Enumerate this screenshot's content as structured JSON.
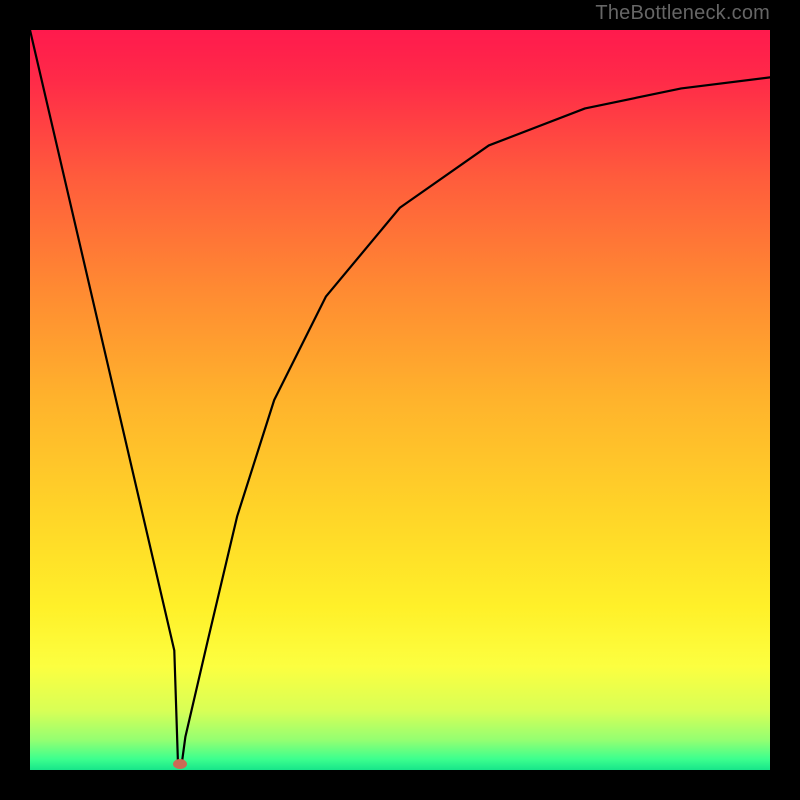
{
  "watermark": "TheBottleneck.com",
  "chart_data": {
    "type": "line",
    "title": "",
    "xlabel": "",
    "ylabel": "",
    "xlim": [
      0,
      100
    ],
    "ylim": [
      0,
      100
    ],
    "grid": false,
    "legend": false,
    "series": [
      {
        "name": "bottleneck-curve",
        "x": [
          0,
          5,
          10,
          15,
          18,
          19.5,
          20,
          20.5,
          21,
          24,
          28,
          33,
          40,
          50,
          62,
          75,
          88,
          100
        ],
        "values": [
          100,
          78.5,
          57,
          35.5,
          22.6,
          16.15,
          0.8,
          0.8,
          4.5,
          17.4,
          34.3,
          50,
          64,
          76,
          84.4,
          89.4,
          92.1,
          93.6
        ],
        "color": "#000000"
      }
    ],
    "marker": {
      "x": 20.3,
      "y": 0.8,
      "color": "#cc6b55"
    },
    "background_gradient": {
      "stops": [
        {
          "offset": 0.0,
          "color": "#ff1a4d"
        },
        {
          "offset": 0.07,
          "color": "#ff2b48"
        },
        {
          "offset": 0.2,
          "color": "#ff5c3c"
        },
        {
          "offset": 0.35,
          "color": "#ff8a32"
        },
        {
          "offset": 0.5,
          "color": "#ffb32c"
        },
        {
          "offset": 0.65,
          "color": "#ffd428"
        },
        {
          "offset": 0.78,
          "color": "#fff029"
        },
        {
          "offset": 0.86,
          "color": "#fcff40"
        },
        {
          "offset": 0.92,
          "color": "#d8ff56"
        },
        {
          "offset": 0.96,
          "color": "#93ff72"
        },
        {
          "offset": 0.985,
          "color": "#3dff8e"
        },
        {
          "offset": 1.0,
          "color": "#17e58a"
        }
      ]
    }
  }
}
